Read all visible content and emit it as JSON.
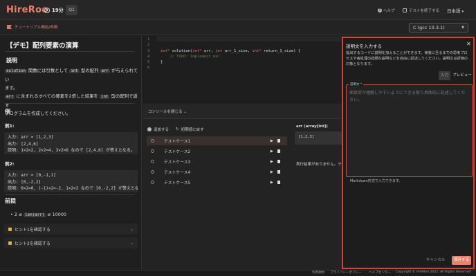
{
  "app": {
    "logo": "HireRoo",
    "timer": "19分",
    "question_badge": "Q1",
    "help": "ヘルプ",
    "end_test": "テストを終了する",
    "language": "日本語"
  },
  "subbar": {
    "tutorial": "チュートリアル開始/再開",
    "compiler": "C (gcc 10.3.1)"
  },
  "problem": {
    "title": "【デモ】配列要素の演算",
    "desc_heading": "説明",
    "desc_line1_a": "solution",
    "desc_line1_b": " 関数には引数として ",
    "desc_line1_c": "int",
    "desc_line1_d": " 型の配列 ",
    "desc_line1_e": "arr",
    "desc_line1_f": " が与えられてい",
    "desc_line2": "ます。",
    "desc_line3_a": "arr",
    "desc_line3_b": " に含まれるすべての要素を2倍した結果を ",
    "desc_line3_c": "int",
    "desc_line3_d": " 型の配列で返す",
    "desc_line4": "プログラムを作成してください。",
    "example_heading": "例",
    "ex1_label": "例1:",
    "ex1_text": "入力: arr = [1,2,3]\n出力: [2,4,6]\n説明: 1×2=2, 2×2=4, 3×2=6 なので [2,4,6] が答えとなる。",
    "ex2_label": "例2:",
    "ex2_text": "入力: arr = [0,-1,1]\n出力: [0,-2,2]\n説明: 0×2=0, (-1)×2=-2, 1×2=2 なので [0,-2,2] が答えとな",
    "constraint_heading": "前提",
    "constraint_a": "2 ≤ ",
    "constraint_b": "len(arr)",
    "constraint_c": " ≤ 10000",
    "hint1": "ヒント1を確認する",
    "hint2": "ヒント2を確認する"
  },
  "editor": {
    "line_numbers": [
      "1",
      "2",
      "3",
      "4",
      "5",
      "6"
    ],
    "line3_kw1": "int*",
    "line3_mid": " solution(",
    "line3_kw2": "int*",
    "line3_mid2": " arr, ",
    "line3_kw3": "int",
    "line3_mid3": " arr_1_size, ",
    "line3_kw4": "int*",
    "line3_end": " return_1_size) {",
    "line4": "    // TODO: Implement me!",
    "line5": "}"
  },
  "console": {
    "toggle": "コンソールを閉じる ⌄",
    "add": "追加する",
    "reset": "初期値に戻す",
    "cases": [
      "テストケース1",
      "テストケース2",
      "テストケース3",
      "テストケース4",
      "テストケース5"
    ],
    "input_label": "arr (array[int])",
    "input_value": "[1,2,3]",
    "result": "実行結果がありません。テ"
  },
  "modal": {
    "title": "説明文を入力する",
    "description": "提出するコードに説明を加えることができます。実装に至るまでの思考プロセスや各処理の詳細な説明などを自由に記述してください。説明文は評価の対象となります。",
    "tab_input": "入力",
    "tab_preview": "プレビュー",
    "field_label": "説明文 *",
    "placeholder": "面接官が理解しやすいようにできる限り具体的に記述してください。",
    "markdown_hint": "Markdown形式で入力できます。",
    "cancel": "キャンセル",
    "save": "保存する"
  },
  "footer": {
    "terms": "利用規約",
    "privacy": "プライバシーポリシー",
    "helpcenter": "ヘルプセンター",
    "copyright": "Copyright © HireRoo 2022. All Rights Reserved"
  },
  "colors": {
    "accent": "#e9816f",
    "modal_border": "#d7442e"
  }
}
